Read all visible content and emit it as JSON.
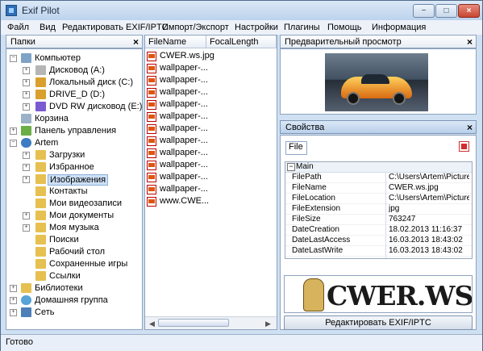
{
  "window": {
    "title": "Exif Pilot"
  },
  "menu": [
    "Файл",
    "Вид",
    "Редактировать EXIF/IPTC",
    "Импорт/Экспорт",
    "Настройки",
    "Плагины",
    "Помощь",
    "Информация"
  ],
  "folders_panel": {
    "title": "Папки",
    "items": [
      {
        "label": "Компьютер",
        "icon": "computer-icon"
      },
      {
        "label": "Дисковод (A:)",
        "icon": "floppy-icon"
      },
      {
        "label": "Локальный диск (C:)",
        "icon": "disk-icon"
      },
      {
        "label": "DRIVE_D (D:)",
        "icon": "disk-icon"
      },
      {
        "label": "DVD RW дисковод (E:)",
        "icon": "dvd-icon"
      },
      {
        "label": "Корзина",
        "icon": "recycle-bin-icon"
      },
      {
        "label": "Панель управления",
        "icon": "control-panel-icon"
      },
      {
        "label": "Artem",
        "icon": "user-icon"
      },
      {
        "label": "Загрузки",
        "icon": "folder-icon"
      },
      {
        "label": "Избранное",
        "icon": "folder-icon"
      },
      {
        "label": "Изображения",
        "icon": "folder-icon",
        "selected": true
      },
      {
        "label": "Контакты",
        "icon": "folder-icon"
      },
      {
        "label": "Мои видеозаписи",
        "icon": "folder-icon"
      },
      {
        "label": "Мои документы",
        "icon": "folder-icon"
      },
      {
        "label": "Моя музыка",
        "icon": "folder-icon"
      },
      {
        "label": "Поиски",
        "icon": "folder-icon"
      },
      {
        "label": "Рабочий стол",
        "icon": "folder-icon"
      },
      {
        "label": "Сохраненные игры",
        "icon": "folder-icon"
      },
      {
        "label": "Ссылки",
        "icon": "folder-icon"
      },
      {
        "label": "Библиотеки",
        "icon": "folder-icon"
      },
      {
        "label": "Домашняя группа",
        "icon": "homegroup-icon"
      },
      {
        "label": "Сеть",
        "icon": "network-icon"
      }
    ]
  },
  "file_list": {
    "columns": [
      "FileName",
      "FocalLength"
    ],
    "files": [
      "CWER.ws.jpg",
      "wallpaper-...",
      "wallpaper-...",
      "wallpaper-...",
      "wallpaper-...",
      "wallpaper-...",
      "wallpaper-...",
      "wallpaper-...",
      "wallpaper-...",
      "wallpaper-...",
      "wallpaper-...",
      "wallpaper-...",
      "www.CWE..."
    ]
  },
  "preview_panel": {
    "title": "Предварительный просмотр"
  },
  "properties_panel": {
    "title": "Свойства",
    "file_label": "File",
    "group": "Main",
    "rows": [
      {
        "key": "FilePath",
        "value": "C:\\Users\\Artem\\Pictures..."
      },
      {
        "key": "FileName",
        "value": "CWER.ws.jpg"
      },
      {
        "key": "FileLocation",
        "value": "C:\\Users\\Artem\\Pictures\\"
      },
      {
        "key": "FileExtension",
        "value": "jpg"
      },
      {
        "key": "FileSize",
        "value": "763247"
      },
      {
        "key": "DateCreation",
        "value": "18.02.2013 11:16:37"
      },
      {
        "key": "DateLastAccess",
        "value": "16.03.2013 18:43:02"
      },
      {
        "key": "DateLastWrite",
        "value": "16.03.2013 18:43:02"
      }
    ]
  },
  "banner": {
    "text": "CWER.WS"
  },
  "edit_button": {
    "label": "Редактировать EXIF/IPTC"
  },
  "status": {
    "text": "Готово"
  },
  "colors": {
    "accent": "#cfe0f3",
    "selection": "#cde0f5",
    "close": "#c6472f"
  }
}
